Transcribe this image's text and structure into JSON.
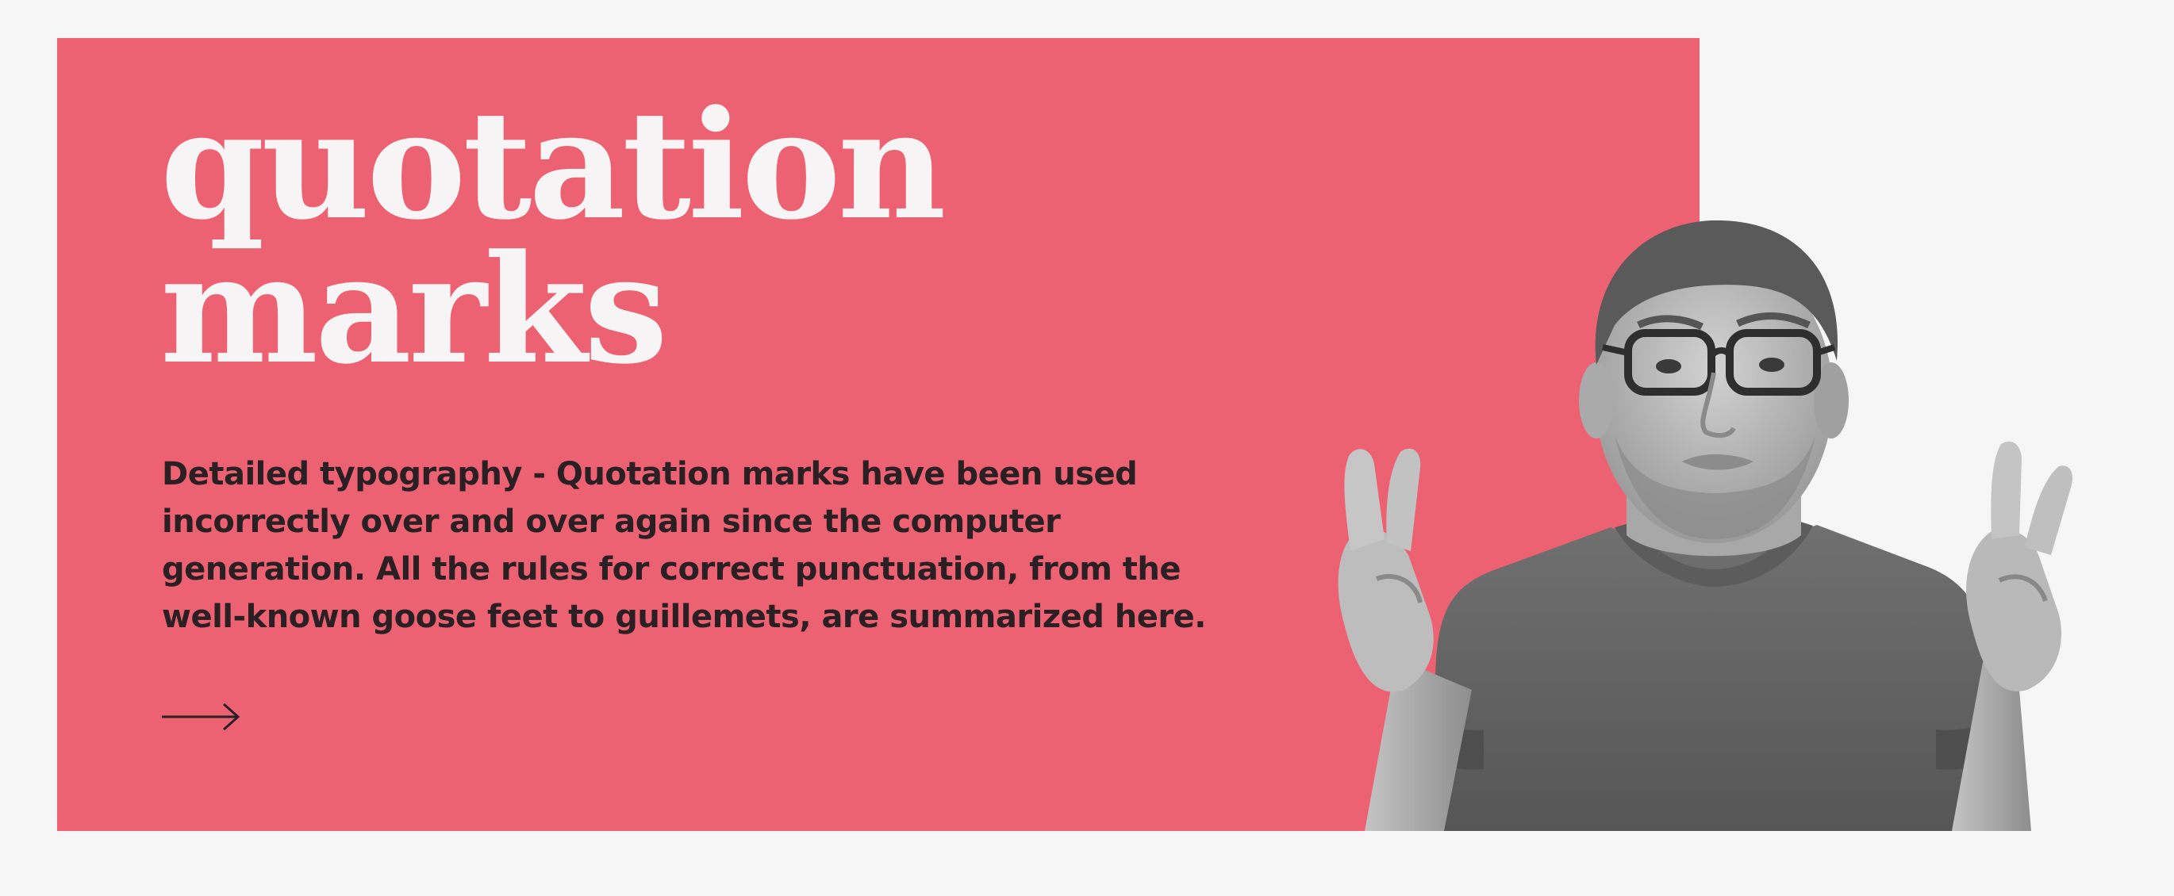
{
  "card": {
    "title_line1": "quotation",
    "title_line2": "marks",
    "description": "Detailed typography - Quotation marks have been used incorrectly over and over again since the computer generation. All the rules for correct punctuation, from the well-known goose feet to guillemets, are summarized here.",
    "arrow_icon": "arrow-right-icon",
    "background_color": "#ec6272"
  },
  "image": {
    "subject": "man-gesturing-air-quotes"
  }
}
